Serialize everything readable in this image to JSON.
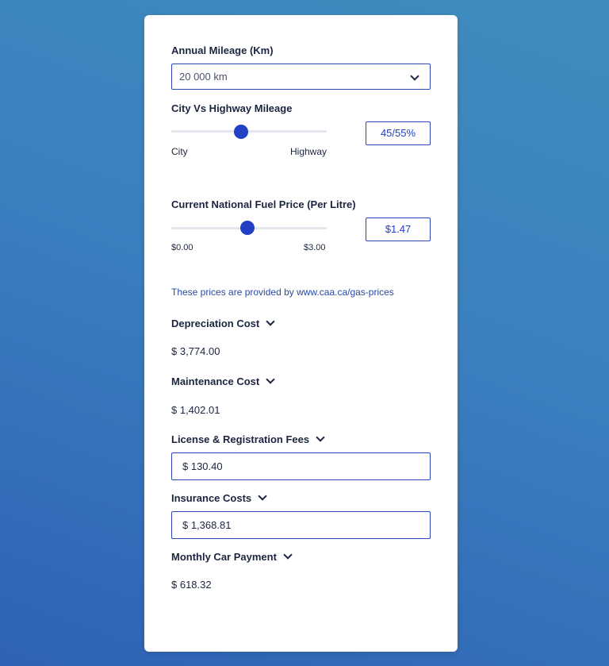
{
  "annual_mileage": {
    "label": "Annual Mileage (Km)",
    "selected": "20 000 km"
  },
  "city_highway": {
    "label": "City Vs Highway Mileage",
    "min_label": "City",
    "max_label": "Highway",
    "value_fraction": 0.45,
    "value_text": "45/55%"
  },
  "fuel_price": {
    "label": "Current National Fuel Price (Per Litre)",
    "min_label": "$0.00",
    "max_label": "$3.00",
    "value": 1.47,
    "value_text": "$1.47",
    "note_prefix": "These prices are provided by ",
    "note_link": "www.caa.ca/gas-prices"
  },
  "depreciation": {
    "label": "Depreciation Cost",
    "amount": "$ 3,774.00"
  },
  "maintenance": {
    "label": "Maintenance Cost",
    "amount": "$ 1,402.01"
  },
  "license": {
    "label": "License & Registration Fees",
    "amount": "$ 130.40"
  },
  "insurance": {
    "label": "Insurance Costs",
    "amount": "$ 1,368.81"
  },
  "car_payment": {
    "label": "Monthly Car Payment",
    "amount": "$ 618.32"
  },
  "colors": {
    "accent": "#2340c4",
    "border": "#2b47b5",
    "link": "#2a4aa0",
    "text": "#1b2540"
  }
}
